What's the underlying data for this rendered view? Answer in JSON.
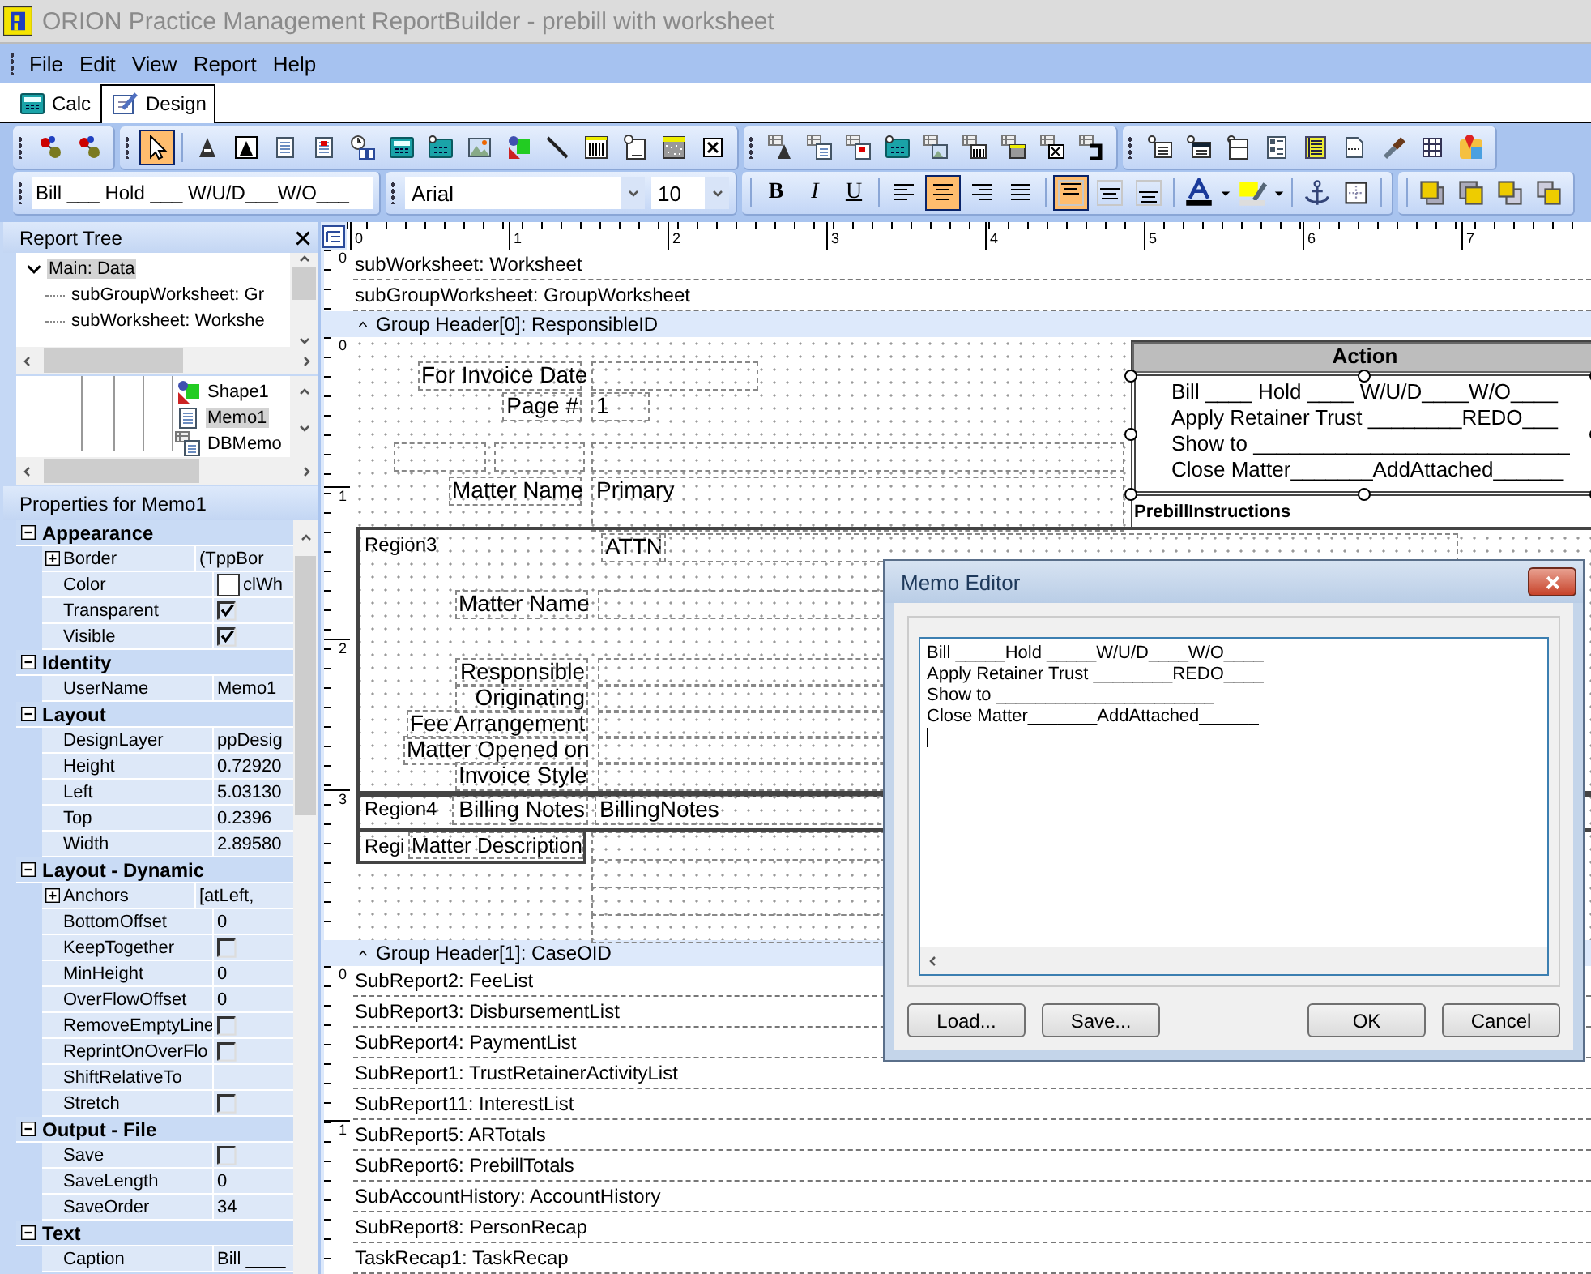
{
  "window": {
    "title": "ORION Practice Management ReportBuilder - prebill with worksheet"
  },
  "menu": [
    "File",
    "Edit",
    "View",
    "Report",
    "Help"
  ],
  "tabs": [
    {
      "label": "Calc",
      "kind": "calc",
      "selected": false
    },
    {
      "label": "Design",
      "kind": "design",
      "selected": true
    }
  ],
  "toolbar": [
    {
      "buttons": [
        {
          "kind": "nodes",
          "selected": false
        },
        {
          "kind": "nodes",
          "selected": false
        }
      ]
    },
    {
      "buttons": [
        {
          "kind": "pointer",
          "selected": true
        },
        {
          "kind": "label",
          "selected": false
        },
        {
          "kind": "boxlabel",
          "selected": false
        },
        {
          "kind": "memo",
          "selected": false
        },
        {
          "kind": "richtext",
          "selected": false
        },
        {
          "kind": "sysvar",
          "selected": false
        },
        {
          "kind": "calc",
          "selected": false
        },
        {
          "kind": "dbcalc",
          "selected": false
        },
        {
          "kind": "image",
          "selected": false
        },
        {
          "kind": "shape",
          "selected": false
        },
        {
          "kind": "line",
          "selected": false
        },
        {
          "kind": "barcode",
          "selected": false
        },
        {
          "kind": "note",
          "selected": false
        },
        {
          "kind": "pattern",
          "selected": false
        },
        {
          "kind": "xbox",
          "selected": false
        }
      ]
    },
    {
      "buttons": [
        {
          "kind": "dblabel",
          "selected": false
        },
        {
          "kind": "dbmemo",
          "selected": false
        },
        {
          "kind": "dbrichtext",
          "selected": false
        },
        {
          "kind": "dbcalc",
          "selected": false
        },
        {
          "kind": "dbimage",
          "selected": false
        },
        {
          "kind": "dbbarcode",
          "selected": false
        },
        {
          "kind": "dbpattern",
          "selected": false
        },
        {
          "kind": "dbxbox",
          "selected": false
        },
        {
          "kind": "bracket",
          "selected": false
        }
      ]
    },
    {
      "buttons": [
        {
          "kind": "region",
          "selected": false
        },
        {
          "kind": "subreport",
          "selected": false
        },
        {
          "kind": "page",
          "selected": false
        },
        {
          "kind": "columns",
          "selected": false
        },
        {
          "kind": "table",
          "selected": false
        },
        {
          "kind": "document",
          "selected": false
        },
        {
          "kind": "brush",
          "selected": false
        },
        {
          "kind": "grid",
          "selected": false
        },
        {
          "kind": "map",
          "selected": false
        }
      ]
    }
  ],
  "format_bar": {
    "caption": "Bill ___ Hold ___ W/U/D___W/O___",
    "font": "Arial",
    "size": "10",
    "style_buttons": [
      {
        "label": "B",
        "kind": "bold",
        "selected": false
      },
      {
        "label": "I",
        "kind": "italic",
        "selected": false
      },
      {
        "label": "U",
        "kind": "underline",
        "selected": false
      }
    ],
    "align_buttons": [
      {
        "kind": "left",
        "selected": false
      },
      {
        "kind": "center",
        "selected": true
      },
      {
        "kind": "right",
        "selected": false
      },
      {
        "kind": "justify",
        "selected": false
      }
    ],
    "valign_buttons": [
      {
        "kind": "top",
        "selected": true
      },
      {
        "kind": "middle",
        "selected": false
      },
      {
        "kind": "bottom",
        "selected": false
      }
    ],
    "tools": [
      {
        "kind": "fontcolor"
      },
      {
        "kind": "highlight"
      },
      {
        "kind": "anchor"
      },
      {
        "kind": "dotbox"
      },
      {
        "kind": "front"
      },
      {
        "kind": "back"
      },
      {
        "kind": "forward"
      },
      {
        "kind": "backward"
      }
    ]
  },
  "report_tree": {
    "title": "Report Tree",
    "items": [
      {
        "label": "Main: Data",
        "selected": true,
        "expanded": true,
        "children": [
          {
            "label": "subGroupWorksheet: Gr",
            "selected": false
          },
          {
            "label": "subWorksheet: Workshe",
            "selected": false
          }
        ]
      }
    ]
  },
  "component_tree": {
    "items": [
      {
        "label": "Shape1",
        "kind": "shape",
        "selected": false
      },
      {
        "label": "Memo1",
        "kind": "memo",
        "selected": true
      },
      {
        "label": "DBMemo",
        "kind": "dbmemo",
        "selected": false
      }
    ]
  },
  "properties": {
    "title": "Properties for Memo1",
    "categories": [
      {
        "label": "Appearance",
        "expanded": true,
        "rows": [
          {
            "name": "Border",
            "kind": "expand",
            "value": "(TppBor"
          },
          {
            "name": "Color",
            "kind": "color",
            "value": "clWh"
          },
          {
            "name": "Transparent",
            "kind": "check",
            "checked": true
          },
          {
            "name": "Visible",
            "kind": "check",
            "checked": true
          }
        ]
      },
      {
        "label": "Identity",
        "expanded": true,
        "rows": [
          {
            "name": "UserName",
            "kind": "text",
            "value": "Memo1"
          }
        ]
      },
      {
        "label": "Layout",
        "expanded": true,
        "rows": [
          {
            "name": "DesignLayer",
            "kind": "text",
            "value": "ppDesig"
          },
          {
            "name": "Height",
            "kind": "text",
            "value": "0.72920"
          },
          {
            "name": "Left",
            "kind": "text",
            "value": "5.03130"
          },
          {
            "name": "Top",
            "kind": "text",
            "value": "0.2396"
          },
          {
            "name": "Width",
            "kind": "text",
            "value": "2.89580"
          }
        ]
      },
      {
        "label": "Layout - Dynamic",
        "expanded": true,
        "rows": [
          {
            "name": "Anchors",
            "kind": "expand",
            "value": "[atLeft,"
          },
          {
            "name": "BottomOffset",
            "kind": "text",
            "value": "0"
          },
          {
            "name": "KeepTogether",
            "kind": "check",
            "checked": false
          },
          {
            "name": "MinHeight",
            "kind": "text",
            "value": "0"
          },
          {
            "name": "OverFlowOffset",
            "kind": "text",
            "value": "0"
          },
          {
            "name": "RemoveEmptyLine",
            "kind": "check",
            "checked": false
          },
          {
            "name": "ReprintOnOverFlo",
            "kind": "check",
            "checked": false
          },
          {
            "name": "ShiftRelativeTo",
            "kind": "text"
          },
          {
            "name": "Stretch",
            "kind": "check",
            "checked": false
          }
        ]
      },
      {
        "label": "Output - File",
        "expanded": true,
        "rows": [
          {
            "name": "Save",
            "kind": "check",
            "checked": false
          },
          {
            "name": "SaveLength",
            "kind": "text",
            "value": "0"
          },
          {
            "name": "SaveOrder",
            "kind": "text",
            "value": "34"
          }
        ]
      },
      {
        "label": "Text",
        "expanded": true,
        "rows": [
          {
            "name": "Caption",
            "kind": "text",
            "value": "Bill ____"
          }
        ]
      }
    ]
  },
  "design": {
    "ruler": [
      "0",
      "1",
      "2",
      "3",
      "4",
      "5",
      "6",
      "7"
    ],
    "sections": [
      {
        "kind": "rows",
        "ruler": [
          "0"
        ],
        "rows": [
          "subWorksheet: Worksheet",
          "subGroupWorksheet: GroupWorksheet"
        ]
      },
      {
        "kind": "header",
        "label": "Group Header[0]: ResponsibleID",
        "expanded": true
      },
      {
        "kind": "canvas",
        "ruler": [
          "0",
          "1",
          "2",
          "3"
        ]
      },
      {
        "kind": "header",
        "label": "Group Header[1]: CaseOID",
        "expanded": true
      },
      {
        "kind": "rows",
        "ruler": [
          "0",
          "1"
        ],
        "rows": [
          "SubReport2: FeeList",
          "SubReport3: DisbursementList",
          "SubReport4: PaymentList",
          "SubReport1: TrustRetainerActivityList",
          "SubReport11: InterestList",
          "SubReport5: ARTotals",
          "SubReport6: PrebillTotals",
          "SubAccountHistory: AccountHistory",
          "SubReport8: PersonRecap",
          "TaskRecap1: TaskRecap"
        ]
      }
    ]
  },
  "header_0": {
    "fields": [
      {
        "label": "For Invoice Date"
      },
      {
        "label": "Page #",
        "value": "1"
      },
      {
        "label": "Matter Name",
        "value": "Primary"
      }
    ],
    "regions": [
      {
        "name": "Region3",
        "fields": [
          {
            "label": "ATTN"
          },
          {
            "label": "Matter Name"
          },
          {
            "label": "Responsible"
          },
          {
            "label": "Originating"
          },
          {
            "label": "Fee Arrangement"
          },
          {
            "label": "Matter Opened on"
          },
          {
            "label": "Invoice Style"
          }
        ]
      },
      {
        "name": "Region4",
        "fields": [
          {
            "label": "Billing Notes",
            "value": "BillingNotes"
          }
        ]
      },
      {
        "name": "Regi",
        "fields": [
          {
            "label": "Matter Description"
          }
        ]
      }
    ],
    "memo": {
      "title": "Action",
      "selected": true,
      "lines": [
        "Bill ____ Hold ____ W/U/D____W/O____",
        "Apply Retainer Trust ________REDO___",
        "Show to ___________________________",
        "Close Matter_______AddAttached______"
      ],
      "caption": "PrebillInstructions"
    }
  },
  "memo_editor": {
    "title": "Memo Editor",
    "lines": [
      "Bill _____Hold _____W/U/D____W/O____",
      "Apply Retainer Trust ________REDO____",
      "Show to ______________________",
      "Close Matter_______AddAttached______"
    ],
    "buttons": [
      {
        "label": "Load...",
        "kind": "left"
      },
      {
        "label": "Save...",
        "kind": "left"
      },
      {
        "label": "OK",
        "kind": "right"
      },
      {
        "label": "Cancel",
        "kind": "right"
      }
    ]
  }
}
